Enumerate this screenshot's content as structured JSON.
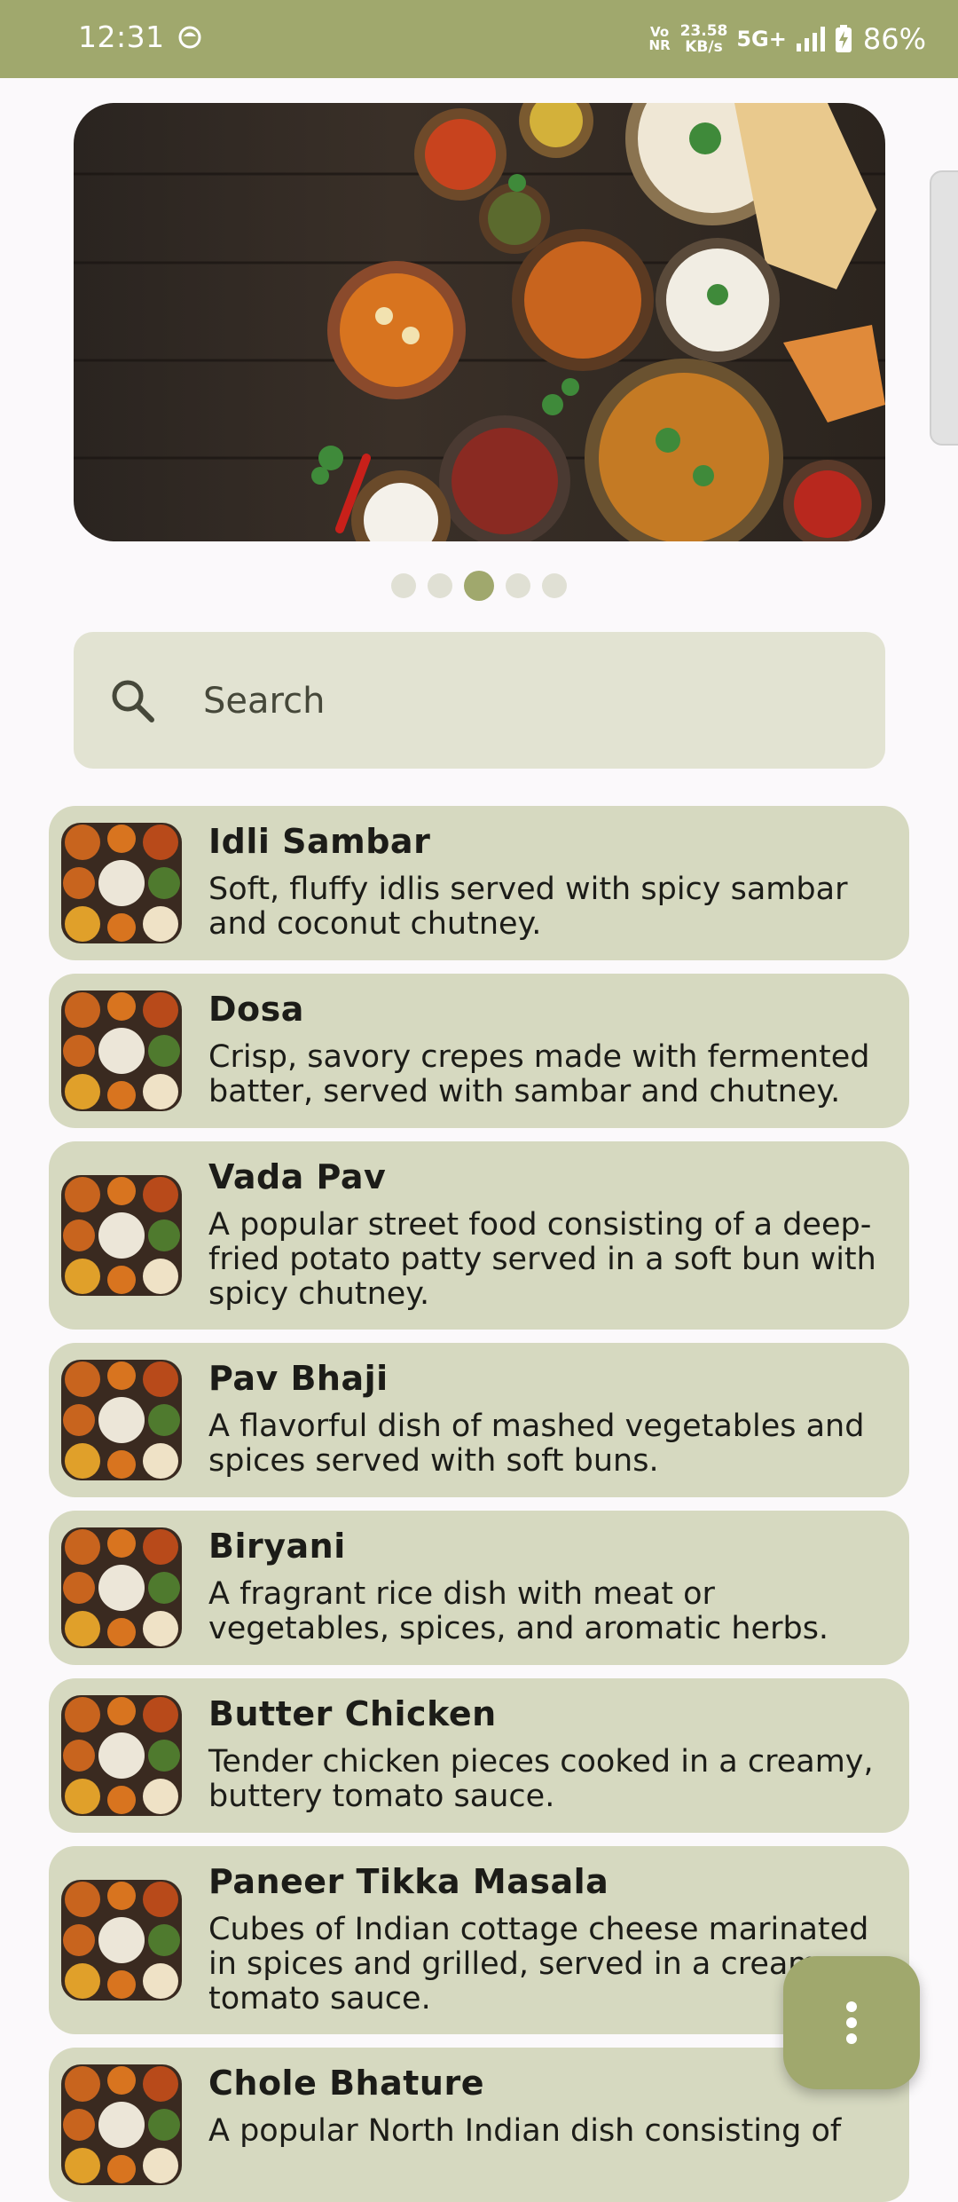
{
  "status_bar": {
    "time": "12:31",
    "volte_top": "Vo",
    "volte_bottom": "NR",
    "speed_value": "23.58",
    "speed_unit": "KB/s",
    "network": "5G+",
    "battery": "86%"
  },
  "search": {
    "placeholder": "Search"
  },
  "carousel": {
    "dot_count": 5,
    "active_index": 2
  },
  "dishes": [
    {
      "name": "Idli Sambar",
      "description": "Soft, fluffy idlis served with spicy sambar and coconut chutney."
    },
    {
      "name": "Dosa",
      "description": "Crisp, savory crepes made with fermented batter, served with sambar and chutney."
    },
    {
      "name": "Vada Pav",
      "description": "A popular street food consisting of a deep-fried potato patty served in a soft bun with spicy chutney."
    },
    {
      "name": "Pav Bhaji",
      "description": "A flavorful dish of mashed vegetables and spices served with soft buns."
    },
    {
      "name": "Biryani",
      "description": "A fragrant rice dish with meat or vegetables, spices, and aromatic herbs."
    },
    {
      "name": "Butter Chicken",
      "description": "Tender chicken pieces cooked in a creamy, buttery tomato sauce."
    },
    {
      "name": "Paneer Tikka Masala",
      "description": "Cubes of Indian cottage cheese marinated in spices and grilled, served in a creamy tomato sauce."
    },
    {
      "name": "Chole Bhature",
      "description": "A popular North Indian dish consisting of"
    }
  ],
  "colors": {
    "accent": "#a0a86d",
    "card": "#d6d9c0",
    "search_bg": "#e2e3d2"
  },
  "icons": {
    "search": "search-icon",
    "fab": "more-vert-icon"
  }
}
